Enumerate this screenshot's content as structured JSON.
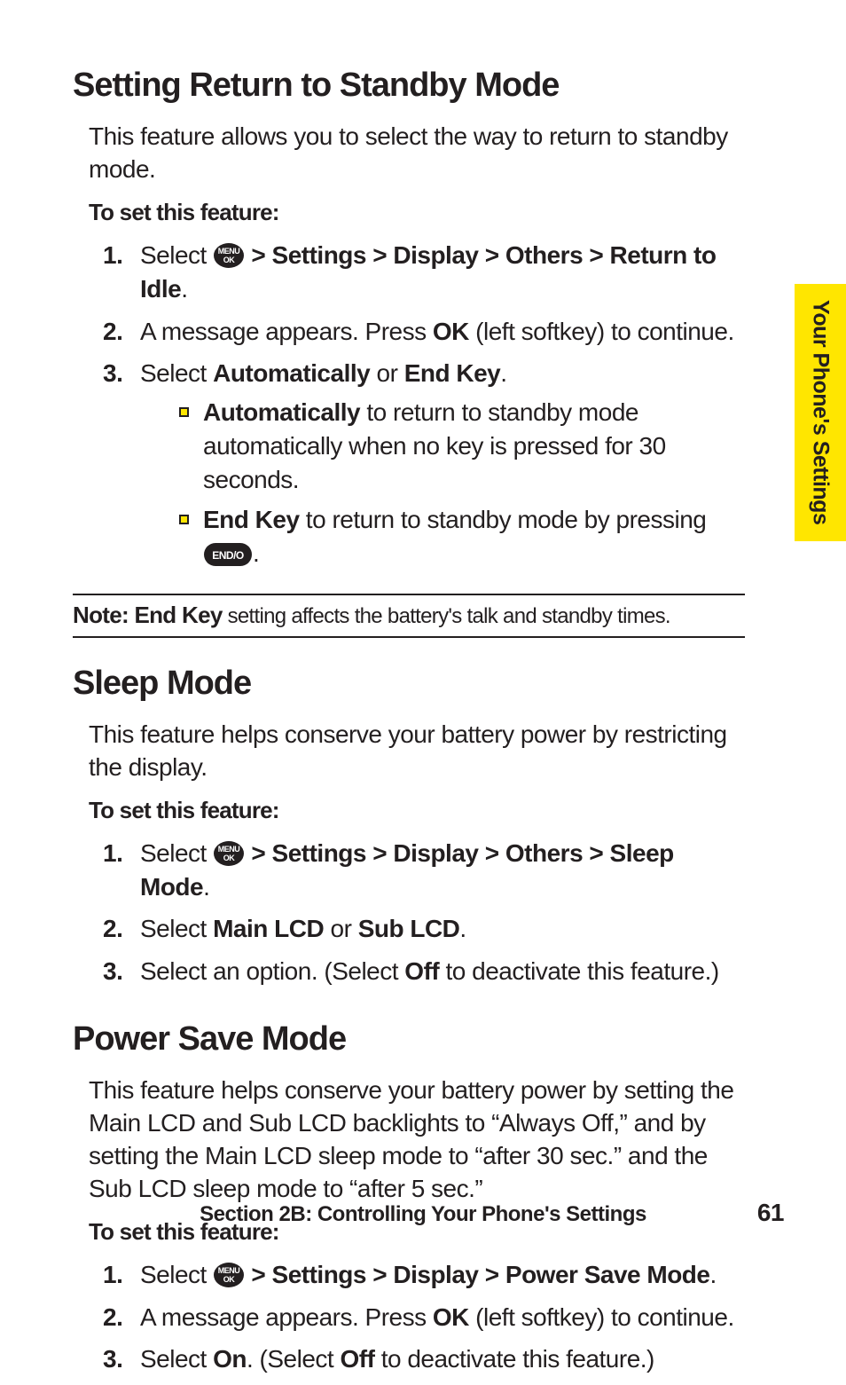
{
  "side_tab": "Your Phone's Settings",
  "icons": {
    "menu_ok_top": "MENU",
    "menu_ok_bottom": "OK",
    "end_key": "END/O"
  },
  "sec1": {
    "title": "Setting Return to Standby Mode",
    "intro": "This feature allows you to select the way to return to standby mode.",
    "lead": "To set this feature:",
    "s1_pre": "Select ",
    "s1_post": " > Settings > Display > Others > Return to Idle",
    "s2_a": "A message appears. Press ",
    "s2_b": "OK",
    "s2_c": " (left softkey) to continue.",
    "s3_a": "Select ",
    "s3_b": "Automatically",
    "s3_c": " or ",
    "s3_d": "End Key",
    "s3_e": ".",
    "b1_a": "Automatically",
    "b1_b": " to return to standby mode automatically when no key is pressed for 30 seconds.",
    "b2_a": "End Key",
    "b2_b": " to return to standby mode by pressing ",
    "b2_c": "."
  },
  "note": {
    "label": "Note: ",
    "bold": "End Key",
    "rest": " setting affects the battery's talk and standby times."
  },
  "sec2": {
    "title": "Sleep Mode",
    "intro": "This feature helps conserve your battery power by restricting the display.",
    "lead": "To set this feature:",
    "s1_pre": "Select ",
    "s1_post": " > Settings > Display > Others > Sleep Mode",
    "s2_a": "Select ",
    "s2_b": "Main LCD",
    "s2_c": " or ",
    "s2_d": "Sub LCD",
    "s2_e": ".",
    "s3_a": "Select an option. (Select ",
    "s3_b": "Off",
    "s3_c": " to deactivate this feature.)"
  },
  "sec3": {
    "title": "Power Save Mode",
    "intro": "This feature helps conserve your battery power by setting the Main LCD and Sub LCD backlights to “Always Off,” and by setting the Main LCD sleep mode to “after 30 sec.” and the Sub LCD sleep mode to “after 5 sec.”",
    "lead": "To set this feature:",
    "s1_pre": "Select ",
    "s1_post": " > Settings > Display > Power Save Mode",
    "s2_a": "A message appears. Press ",
    "s2_b": "OK",
    "s2_c": " (left softkey) to continue.",
    "s3_a": "Select ",
    "s3_b": "On",
    "s3_c": ". (Select ",
    "s3_d": "Off",
    "s3_e": " to deactivate this feature.)"
  },
  "footer": {
    "text": "Section 2B: Controlling Your Phone's Settings",
    "page": "61"
  }
}
